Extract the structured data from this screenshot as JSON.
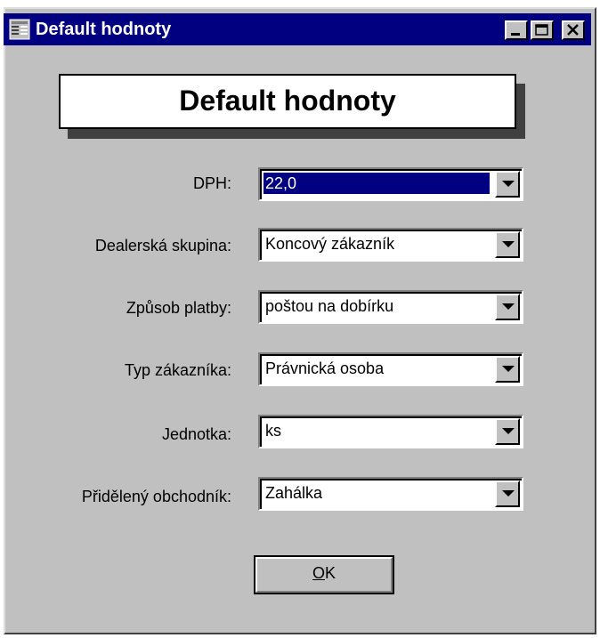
{
  "window": {
    "title": "Default hodnoty"
  },
  "banner": {
    "text": "Default hodnoty"
  },
  "fields": [
    {
      "label": "DPH:",
      "value": "22,0"
    },
    {
      "label": "Dealerská skupina:",
      "value": "Koncový zákazník"
    },
    {
      "label": "Způsob platby:",
      "value": "poštou na dobírku"
    },
    {
      "label": "Typ zákazníka:",
      "value": "Právnická osoba"
    },
    {
      "label": "Jednotka:",
      "value": "ks"
    },
    {
      "label": "Přidělený obchodník:",
      "value": "Zahálka"
    }
  ],
  "ok_button": {
    "mnemonic": "O",
    "rest": "K"
  },
  "colors": {
    "titlebar": "#000080",
    "face": "#c0c0c0",
    "selection": "#000080"
  }
}
